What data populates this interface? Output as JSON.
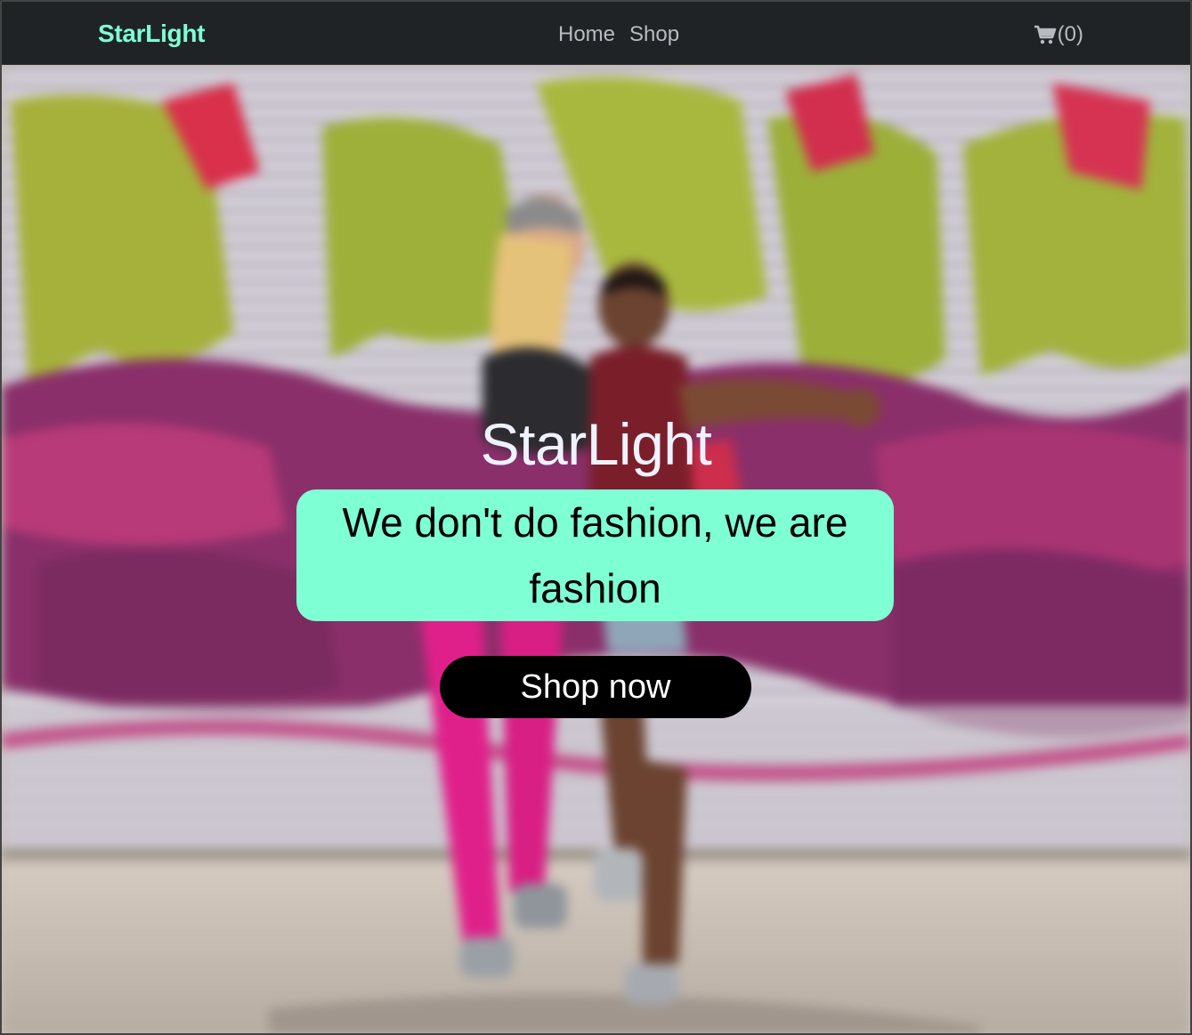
{
  "navbar": {
    "brand": "StarLight",
    "links": [
      "Home",
      "Shop"
    ],
    "cart_label": "(0)",
    "cart_icon": "cart-icon"
  },
  "hero": {
    "title": "StarLight",
    "tagline": "We don't do fashion, we are fashion",
    "cta_label": "Shop now"
  },
  "colors": {
    "brand": "#7fffd4",
    "navbar_bg": "#1f2326",
    "nav_text": "#b8bcc0",
    "cta_bg": "#000000"
  }
}
